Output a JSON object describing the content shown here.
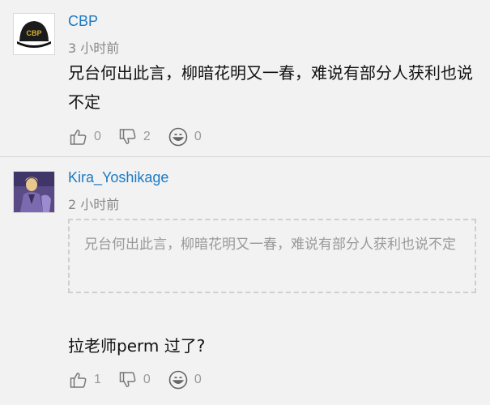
{
  "comments": [
    {
      "username": "CBP",
      "time": "3 小时前",
      "avatar_text": "CBP",
      "text": "兄台何出此言，柳暗花明又一春，难说有部分人获利也说不定",
      "likes": "0",
      "dislikes": "2",
      "reactions": "0"
    },
    {
      "username": "Kira_Yoshikage",
      "time": "2 小时前",
      "quote": "兄台何出此言，柳暗花明又一春，难说有部分人获利也说不定",
      "text": "拉老师perm 过了?",
      "likes": "1",
      "dislikes": "0",
      "reactions": "0"
    }
  ],
  "colors": {
    "link": "#1a7ac5",
    "muted": "#999999",
    "background": "#f2f2f2"
  }
}
